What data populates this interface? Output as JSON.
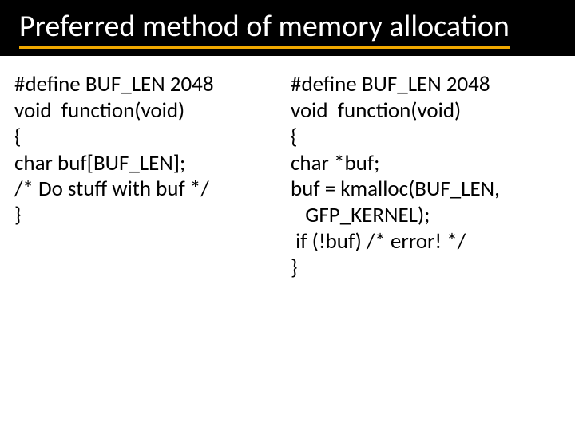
{
  "title": "Preferred method of memory allocation",
  "left": {
    "lines": [
      "#define BUF_LEN 2048",
      "void  function(void)",
      "{",
      "char buf[BUF_LEN];",
      "/* Do stuff with buf */",
      "}"
    ]
  },
  "right": {
    "lines": [
      "#define BUF_LEN 2048",
      "void  function(void)",
      "{",
      "char *buf;",
      "buf = kmalloc(BUF_LEN,",
      "   GFP_KERNEL);",
      " if (!buf) /* error! */",
      "}"
    ]
  }
}
